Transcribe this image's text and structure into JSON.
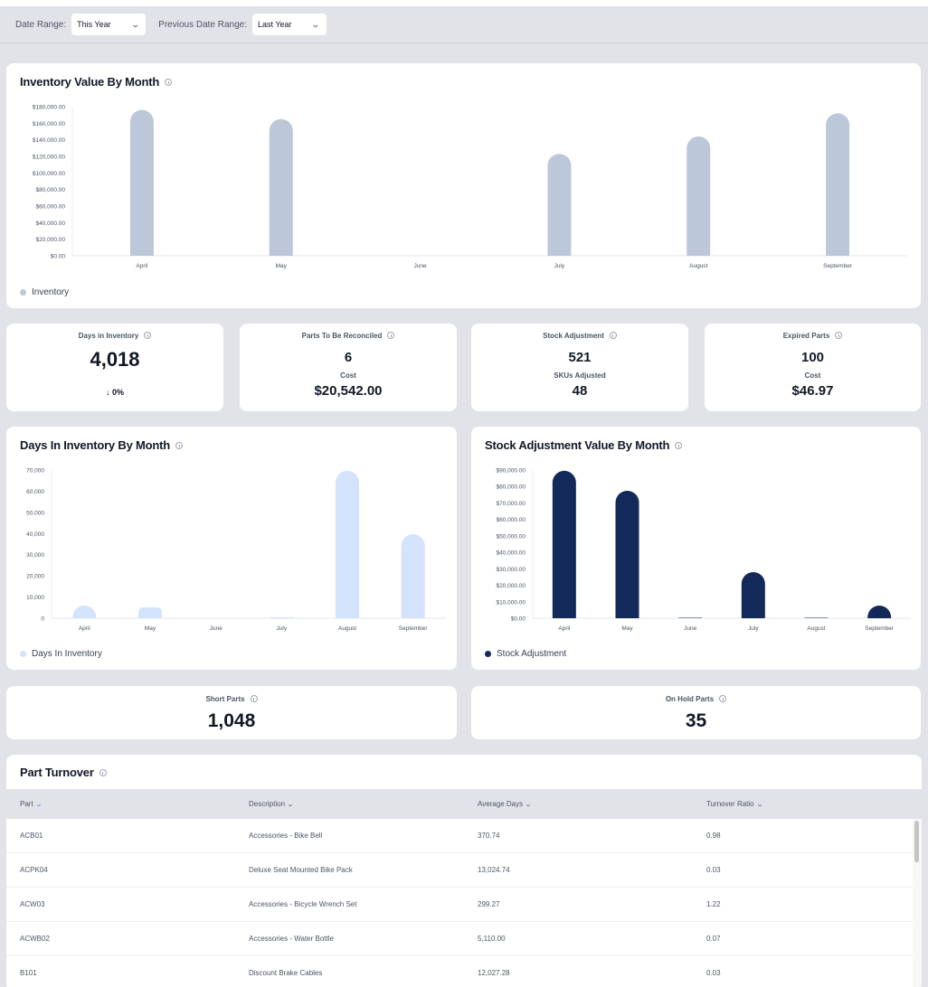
{
  "filters": {
    "date_range_label": "Date Range:",
    "date_range_value": "This Year",
    "prev_date_range_label": "Previous Date Range:",
    "prev_date_range_value": "Last Year"
  },
  "colors": {
    "inventory_bar": "#bcc7d9",
    "days_bar": "#d2e3fb",
    "stock_bar": "#13295a",
    "sort_active": "#3b82f6"
  },
  "inventory_chart": {
    "title": "Inventory Value By Month",
    "legend": "Inventory"
  },
  "kpis": {
    "days_in_inventory": {
      "label": "Days in Inventory",
      "value": "4,018",
      "change": "0%",
      "change_icon": "↓"
    },
    "parts_to_reconcile": {
      "label": "Parts To Be Reconciled",
      "value": "6",
      "sub_label": "Cost",
      "sub_value": "$20,542.00"
    },
    "stock_adjustment": {
      "label": "Stock Adjustment",
      "value": "521",
      "sub_label": "SKUs Adjusted",
      "sub_value": "48"
    },
    "expired_parts": {
      "label": "Expired Parts",
      "value": "100",
      "sub_label": "Cost",
      "sub_value": "$46.97"
    },
    "short_parts": {
      "label": "Short Parts",
      "value": "1,048"
    },
    "on_hold_parts": {
      "label": "On Hold Parts",
      "value": "35"
    }
  },
  "days_chart": {
    "title": "Days In Inventory By Month",
    "legend": "Days In Inventory"
  },
  "stock_chart": {
    "title": "Stock Adjustment Value By Month",
    "legend": "Stock Adjustment"
  },
  "part_turnover": {
    "title": "Part Turnover",
    "columns": [
      "Part",
      "Description",
      "Average Days",
      "Turnover Ratio"
    ],
    "rows": [
      [
        "ACB01",
        "Accessories - Bike Bell",
        "370.74",
        "0.98"
      ],
      [
        "ACPK04",
        "Deluxe Seat Mounted Bike Pack",
        "13,024.74",
        "0.03"
      ],
      [
        "ACW03",
        "Accessories - Bicycle Wrench Set",
        "299.27",
        "1.22"
      ],
      [
        "ACWB02",
        "Accessories - Water Bottle",
        "5,110.00",
        "0.07"
      ],
      [
        "B101",
        "Discount Brake Cables",
        "12,027.28",
        "0.03"
      ]
    ]
  },
  "chart_data": [
    {
      "type": "bar",
      "title": "Inventory Value By Month",
      "categories": [
        "April",
        "May",
        "June",
        "July",
        "August",
        "September"
      ],
      "series": [
        {
          "name": "Inventory",
          "values": [
            176000,
            165000,
            0,
            123000,
            144000,
            172000
          ]
        }
      ],
      "yticks": [
        "$0.00",
        "$20,000.00",
        "$40,000.00",
        "$60,000.00",
        "$80,000.00",
        "$100,000.00",
        "$120,000.00",
        "$140,000.00",
        "$160,000.00",
        "$180,000.00"
      ],
      "ylim": [
        0,
        180000
      ],
      "xlabel": "",
      "ylabel": "",
      "legend": "bottom-left"
    },
    {
      "type": "bar",
      "title": "Days In Inventory By Month",
      "categories": [
        "April",
        "May",
        "June",
        "July",
        "August",
        "September"
      ],
      "series": [
        {
          "name": "Days In Inventory",
          "values": [
            6000,
            5100,
            0,
            500,
            69600,
            39700
          ]
        }
      ],
      "yticks": [
        "0",
        "10,000",
        "20,000",
        "30,000",
        "40,000",
        "50,000",
        "60,000",
        "70,000"
      ],
      "ylim": [
        0,
        70000
      ],
      "xlabel": "",
      "ylabel": "",
      "legend": "bottom-left"
    },
    {
      "type": "bar",
      "title": "Stock Adjustment Value By Month",
      "categories": [
        "April",
        "May",
        "June",
        "July",
        "August",
        "September"
      ],
      "series": [
        {
          "name": "Stock Adjustment",
          "values": [
            89500,
            77400,
            300,
            28000,
            300,
            7700
          ]
        }
      ],
      "yticks": [
        "$0.00",
        "$10,000.00",
        "$20,000.00",
        "$30,000.00",
        "$40,000.00",
        "$50,000.00",
        "$60,000.00",
        "$70,000.00",
        "$80,000.00",
        "$90,000.00"
      ],
      "ylim": [
        0,
        90000
      ],
      "xlabel": "",
      "ylabel": "",
      "legend": "bottom-left"
    }
  ]
}
